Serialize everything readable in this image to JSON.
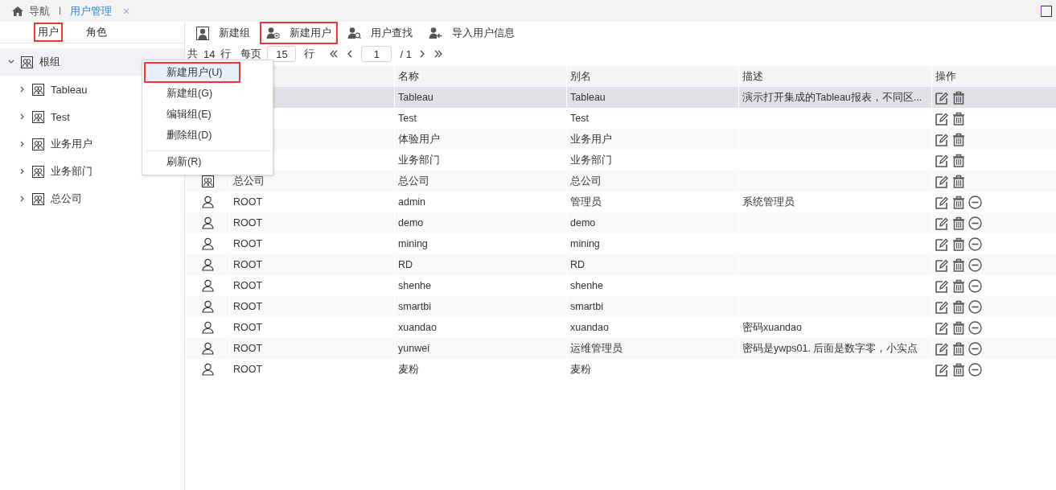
{
  "top_tabs": [
    {
      "label": "导航",
      "kind": "home",
      "selected": false
    },
    {
      "label": "用户管理",
      "kind": "page",
      "selected": true,
      "close": "×"
    }
  ],
  "side_tabs": [
    {
      "label": "用户",
      "highlighted": true
    },
    {
      "label": "角色",
      "highlighted": false
    }
  ],
  "tree": [
    {
      "label": "根组",
      "expanded": true,
      "selected": true,
      "children": [
        {
          "label": "Tableau",
          "expanded": false,
          "selected": false
        },
        {
          "label": "Test",
          "expanded": false,
          "selected": false
        },
        {
          "label": "业务用户",
          "expanded": false,
          "selected": false
        },
        {
          "label": "业务部门",
          "expanded": false,
          "selected": false
        },
        {
          "label": "总公司",
          "expanded": false,
          "selected": false
        }
      ]
    }
  ],
  "context_menu": [
    {
      "label": "新建用户(U)",
      "selected": true,
      "highlighted": true,
      "separator_before": false
    },
    {
      "label": "新建组(G)",
      "selected": false,
      "highlighted": false,
      "separator_before": false
    },
    {
      "label": "编辑组(E)",
      "selected": false,
      "highlighted": false,
      "separator_before": false
    },
    {
      "label": "删除组(D)",
      "selected": false,
      "highlighted": false,
      "separator_before": false
    },
    {
      "label": "刷新(R)",
      "selected": false,
      "highlighted": false,
      "separator_before": true
    }
  ],
  "toolbar": [
    {
      "label": "新建组",
      "kind": "new-group",
      "highlighted": false
    },
    {
      "label": "新建用户",
      "kind": "new-user",
      "highlighted": true
    },
    {
      "label": "用户查找",
      "kind": "find-user",
      "highlighted": false
    },
    {
      "label": "导入用户信息",
      "kind": "import-user",
      "highlighted": false
    }
  ],
  "pager": {
    "total_prefix": "共",
    "total": "14",
    "total_suffix": "行",
    "per_page_label": "每页",
    "per_page": "15",
    "per_page_suffix": "行",
    "page": "1",
    "page_count": "/ 1"
  },
  "table": {
    "columns": {
      "name": "名称",
      "alias": "别名",
      "description": "描述",
      "actions": "操作"
    },
    "rows": [
      {
        "kind": "group",
        "name": "Tableau",
        "alias": "Tableau",
        "description": "演示打开集成的Tableau报表，不同区...",
        "selected": true
      },
      {
        "kind": "group",
        "name": "Test",
        "alias": "Test",
        "selected": false
      },
      {
        "kind": "group",
        "name": "体验用户",
        "alias": "业务用户",
        "selected": false
      },
      {
        "kind": "group",
        "name": "业务部门",
        "alias": "业务部门",
        "selected": false
      },
      {
        "kind": "group",
        "parent": "总公司",
        "name": "总公司",
        "alias": "总公司",
        "selected": false
      },
      {
        "kind": "user",
        "parent": "ROOT",
        "name": "admin",
        "alias": "管理员",
        "description": "系统管理员",
        "selected": false
      },
      {
        "kind": "user",
        "parent": "ROOT",
        "name": "demo",
        "alias": "demo",
        "selected": false
      },
      {
        "kind": "user",
        "parent": "ROOT",
        "name": "mining",
        "alias": "mining",
        "selected": false
      },
      {
        "kind": "user",
        "parent": "ROOT",
        "name": "RD",
        "alias": "RD",
        "selected": false
      },
      {
        "kind": "user",
        "parent": "ROOT",
        "name": "shenhe",
        "alias": "shenhe",
        "selected": false
      },
      {
        "kind": "user",
        "parent": "ROOT",
        "name": "smartbi",
        "alias": "smartbi",
        "selected": false
      },
      {
        "kind": "user",
        "parent": "ROOT",
        "name": "xuandao",
        "alias": "xuandao",
        "description": "密码xuandao",
        "selected": false
      },
      {
        "kind": "user",
        "parent": "ROOT",
        "name": "yunwei",
        "alias": "运维管理员",
        "description": "密码是ywps01. 后面是数字零，小实点",
        "selected": false
      },
      {
        "kind": "user",
        "parent": "ROOT",
        "name": "麦粉",
        "alias": "麦粉",
        "selected": false
      }
    ]
  }
}
